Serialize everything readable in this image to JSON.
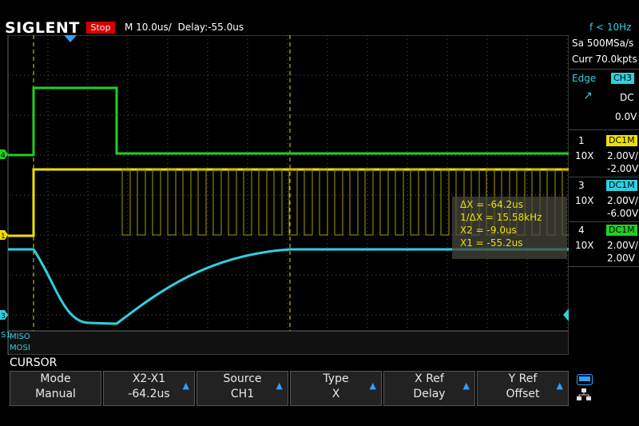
{
  "header": {
    "brand": "SIGLENT",
    "run_state": "Stop",
    "timebase": "M 10.0us/",
    "delay": "Delay:-55.0us",
    "trigger_freq": "f < 10Hz"
  },
  "acquisition": {
    "sample_rate": "Sa 500MSa/s",
    "memory": "Curr 70.0kpts"
  },
  "trigger": {
    "type": "Edge",
    "source": "CH3",
    "coupling": "DC",
    "level": "0.0V"
  },
  "channels": [
    {
      "num": "1",
      "coupling": "DC1M",
      "probe": "10X",
      "scale": "2.00V/",
      "offset": "-2.00V",
      "color": "#f0e000"
    },
    {
      "num": "3",
      "coupling": "DC1M",
      "probe": "10X",
      "scale": "2.00V/",
      "offset": "-6.00V",
      "color": "#2fd0e0"
    },
    {
      "num": "4",
      "coupling": "DC1M",
      "probe": "10X",
      "scale": "2.00V/",
      "offset": "2.00V",
      "color": "#20d020"
    }
  ],
  "cursor_readout": {
    "dx": "ΔX = -64.2us",
    "inv_dx": "1/ΔX = 15.58kHz",
    "x2": "X2 = -9.0us",
    "x1": "X1 = -55.2us"
  },
  "bus_labels": {
    "prefix": "S1",
    "miso": "MISO",
    "mosi": "MOSI"
  },
  "marker_labels": {
    "ch4": "4",
    "ch1": "1",
    "ch3": "3"
  },
  "menu_title": "CURSOR",
  "softkeys": [
    {
      "title": "Mode",
      "value": "Manual",
      "arrow": false
    },
    {
      "title": "X2-X1",
      "value": "-64.2us",
      "arrow": true
    },
    {
      "title": "Source",
      "value": "CH1",
      "arrow": true
    },
    {
      "title": "Type",
      "value": "X",
      "arrow": true
    },
    {
      "title": "X Ref",
      "value": "Delay",
      "arrow": true
    },
    {
      "title": "Y Ref",
      "value": "Offset",
      "arrow": true
    }
  ]
}
